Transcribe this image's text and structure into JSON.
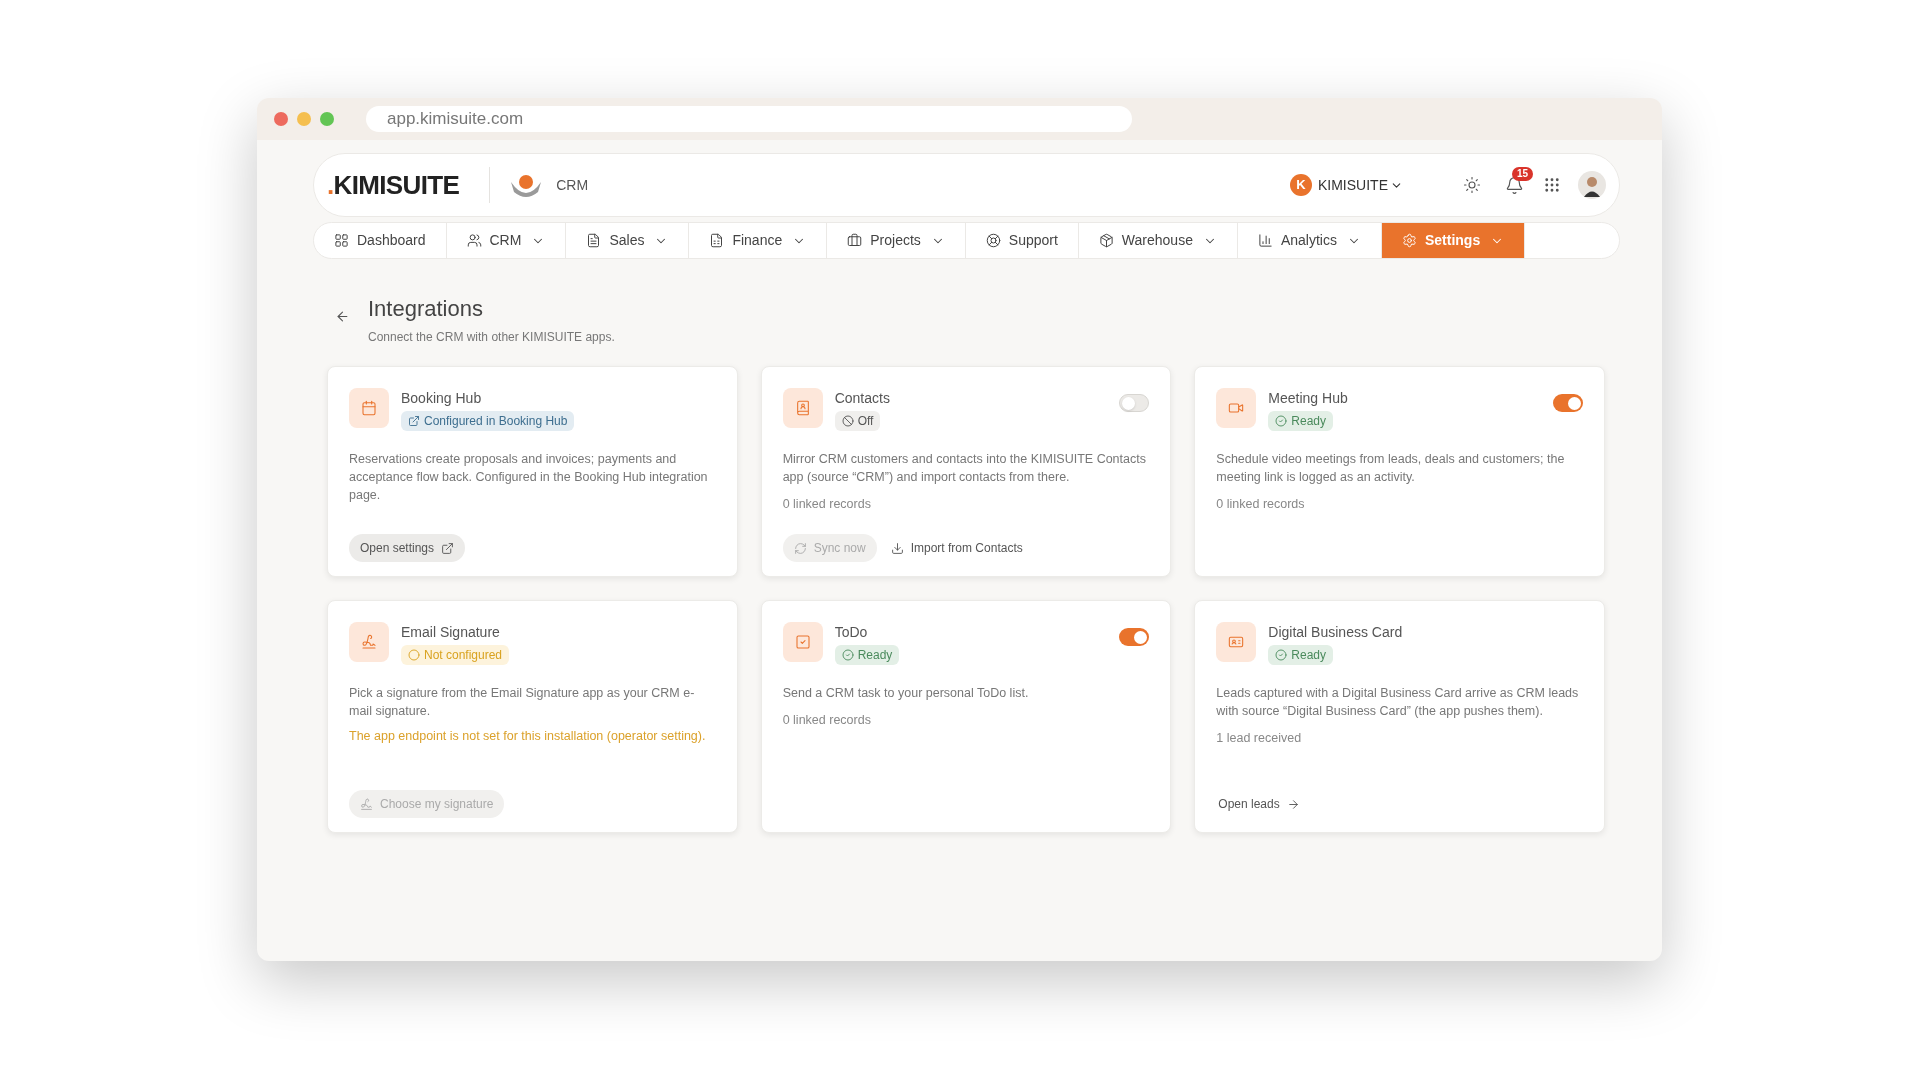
{
  "browser": {
    "address": "app.kimisuite.com"
  },
  "header": {
    "logo_dot": ".",
    "logo_name": "KIMISUITE",
    "app_name": "CRM",
    "workspace": {
      "initial": "K",
      "name": "KIMISUITE"
    },
    "notifications_count": "15"
  },
  "nav": [
    {
      "label": "Dashboard",
      "selected": false,
      "has_menu": false
    },
    {
      "label": "CRM",
      "selected": false,
      "has_menu": true
    },
    {
      "label": "Sales",
      "selected": false,
      "has_menu": true
    },
    {
      "label": "Finance",
      "selected": false,
      "has_menu": true
    },
    {
      "label": "Projects",
      "selected": false,
      "has_menu": true
    },
    {
      "label": "Support",
      "selected": false,
      "has_menu": false
    },
    {
      "label": "Warehouse",
      "selected": false,
      "has_menu": true
    },
    {
      "label": "Analytics",
      "selected": false,
      "has_menu": true
    },
    {
      "label": "Settings",
      "selected": true,
      "has_menu": true
    }
  ],
  "page": {
    "title": "Integrations",
    "subtitle": "Connect the CRM with other KIMISUITE apps."
  },
  "integrations": [
    {
      "name": "Booking Hub",
      "status": {
        "kind": "link",
        "label": "Configured in Booking Hub"
      },
      "description": "Reservations create proposals and invoices; payments and acceptance flow back. Configured in the Booking Hub integration page.",
      "actions": [
        {
          "kind": "button",
          "label": "Open settings",
          "disabled": false
        }
      ]
    },
    {
      "name": "Contacts",
      "status": {
        "kind": "off",
        "label": "Off"
      },
      "toggle": {
        "on": false
      },
      "description": "Mirror CRM customers and contacts into the KIMISUITE Contacts app (source “CRM”) and import contacts from there.",
      "count": "0 linked records",
      "actions": [
        {
          "kind": "button",
          "label": "Sync now",
          "disabled": true
        },
        {
          "kind": "link",
          "label": "Import from Contacts",
          "disabled": false
        }
      ]
    },
    {
      "name": "Meeting Hub",
      "status": {
        "kind": "ready",
        "label": "Ready"
      },
      "toggle": {
        "on": true
      },
      "description": "Schedule video meetings from leads, deals and customers; the meeting link is logged as an activity.",
      "count": "0 linked records"
    },
    {
      "name": "Email Signature",
      "status": {
        "kind": "warning",
        "label": "Not configured"
      },
      "description": "Pick a signature from the Email Signature app as your CRM e-mail signature.",
      "warning": "The app endpoint is not set for this installation (operator setting).",
      "actions": [
        {
          "kind": "button",
          "label": "Choose my signature",
          "disabled": true
        }
      ]
    },
    {
      "name": "ToDo",
      "status": {
        "kind": "ready",
        "label": "Ready"
      },
      "toggle": {
        "on": true
      },
      "description": "Send a CRM task to your personal ToDo list.",
      "count": "0 linked records"
    },
    {
      "name": "Digital Business Card",
      "status": {
        "kind": "ready",
        "label": "Ready"
      },
      "description": "Leads captured with a Digital Business Card arrive as CRM leads with source “Digital Business Card” (the app pushes them).",
      "count": "1 lead received",
      "actions": [
        {
          "kind": "link",
          "label": "Open leads",
          "disabled": false
        }
      ]
    }
  ]
}
